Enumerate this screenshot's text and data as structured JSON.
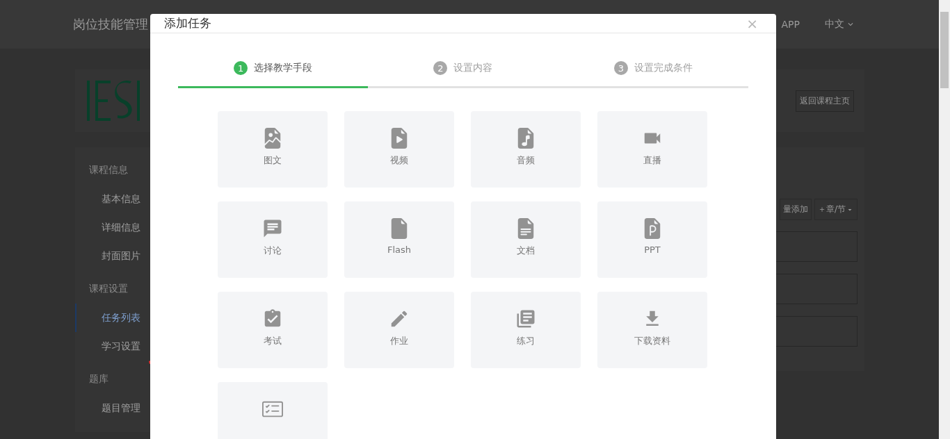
{
  "header": {
    "title": "岗位技能管理",
    "links": [
      "APP"
    ],
    "language": "中文"
  },
  "back_button": "返回课程主页",
  "sidebar": [
    {
      "title": "课程信息",
      "items": [
        {
          "label": "基本信息",
          "selected": false
        },
        {
          "label": "详细信息",
          "selected": false
        },
        {
          "label": "封面图片",
          "selected": false
        }
      ]
    },
    {
      "title": "课程设置",
      "items": [
        {
          "label": "任务列表",
          "selected": true
        },
        {
          "label": "学习设置",
          "selected": false
        }
      ]
    },
    {
      "title": "题库",
      "items": [
        {
          "label": "题目管理",
          "selected": false
        }
      ]
    }
  ],
  "toolbar": {
    "batch_add": "量添加",
    "chapter": "＋章/节"
  },
  "modal": {
    "title": "添加任务",
    "close": "×",
    "steps": [
      {
        "number": "1",
        "label": "选择教学手段",
        "selected": true
      },
      {
        "number": "2",
        "label": "设置内容",
        "selected": false
      },
      {
        "number": "3",
        "label": "设置完成条件",
        "selected": false
      }
    ],
    "types": [
      {
        "kind": "image",
        "label": "图文"
      },
      {
        "kind": "video",
        "label": "视频"
      },
      {
        "kind": "audio",
        "label": "音频"
      },
      {
        "kind": "live",
        "label": "直播"
      },
      {
        "kind": "discussion",
        "label": "讨论"
      },
      {
        "kind": "flash",
        "label": "Flash"
      },
      {
        "kind": "document",
        "label": "文档"
      },
      {
        "kind": "ppt",
        "label": "PPT"
      },
      {
        "kind": "exam",
        "label": "考试"
      },
      {
        "kind": "homework",
        "label": "作业"
      },
      {
        "kind": "practice",
        "label": "练习"
      },
      {
        "kind": "download",
        "label": "下载资料"
      },
      {
        "kind": "checklist"
      }
    ]
  }
}
